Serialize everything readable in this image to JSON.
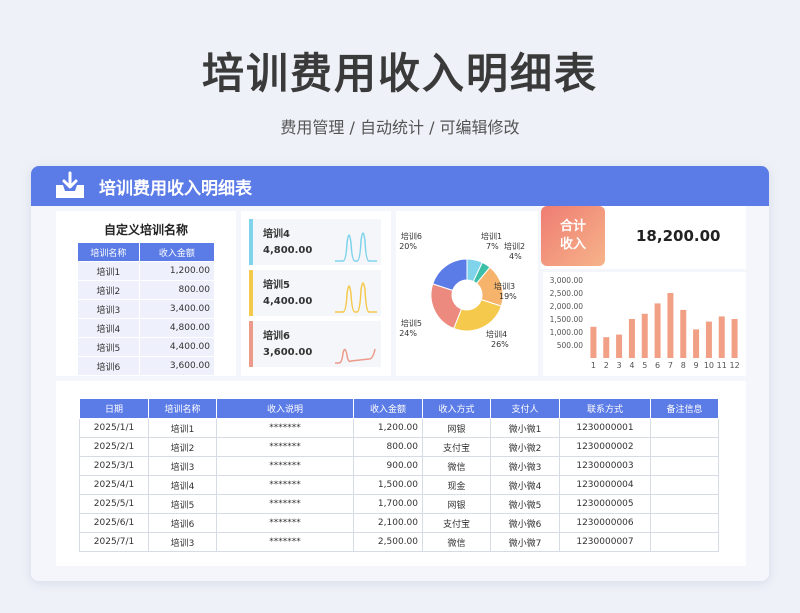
{
  "main_title": "培训费用收入明细表",
  "sub_title": "费用管理 /  自动统计  /  可编辑修改",
  "card_title": "培训费用收入明细表",
  "colors": {
    "accent": "#5b7be6",
    "orange": "#f0907a"
  },
  "custom_table": {
    "title": "自定义培训名称",
    "headers": [
      "培训名称",
      "收入金额"
    ],
    "rows": [
      [
        "培训1",
        "1,200.00"
      ],
      [
        "培训2",
        "800.00"
      ],
      [
        "培训3",
        "3,400.00"
      ],
      [
        "培训4",
        "4,800.00"
      ],
      [
        "培训5",
        "4,400.00"
      ],
      [
        "培训6",
        "3,600.00"
      ]
    ]
  },
  "mini_cards": [
    {
      "name": "培训4",
      "value": "4,800.00",
      "color": "#7fd3ea"
    },
    {
      "name": "培训5",
      "value": "4,400.00",
      "color": "#f5c94c"
    },
    {
      "name": "培训6",
      "value": "3,600.00",
      "color": "#ec9a8a"
    }
  ],
  "total": {
    "label_line1": "合计",
    "label_line2": "收入",
    "value": "18,200.00"
  },
  "chart_data": [
    {
      "type": "pie",
      "labels": [
        "培训1",
        "培训2",
        "培训3",
        "培训4",
        "培训5",
        "培训6"
      ],
      "values": [
        7,
        4,
        19,
        26,
        24,
        20
      ],
      "label_texts": [
        "7%",
        "4%",
        "19%",
        "26%",
        "24%",
        "20%"
      ],
      "colors": [
        "#7fd3ea",
        "#3cbfa7",
        "#f5b36c",
        "#f5c94c",
        "#ec8a80",
        "#5b7be6"
      ]
    },
    {
      "type": "bar",
      "categories": [
        "1",
        "2",
        "3",
        "4",
        "5",
        "6",
        "7",
        "8",
        "9",
        "10",
        "11",
        "12"
      ],
      "values": [
        1200,
        800,
        900,
        1500,
        1700,
        2100,
        2500,
        1850,
        1100,
        1400,
        1600,
        1500
      ],
      "ylim": [
        0,
        3000
      ],
      "yticks": [
        "500.00",
        "1,000.00",
        "1,500.00",
        "2,000.00",
        "2,500.00",
        "3,000.00"
      ]
    }
  ],
  "data_table": {
    "headers": [
      "日期",
      "培训名称",
      "收入说明",
      "收入金额",
      "收入方式",
      "支付人",
      "联系方式",
      "备注信息"
    ],
    "rows": [
      [
        "2025/1/1",
        "培训1",
        "*******",
        "1,200.00",
        "网银",
        "微小微1",
        "1230000001",
        ""
      ],
      [
        "2025/2/1",
        "培训2",
        "*******",
        "800.00",
        "支付宝",
        "微小微2",
        "1230000002",
        ""
      ],
      [
        "2025/3/1",
        "培训3",
        "*******",
        "900.00",
        "微信",
        "微小微3",
        "1230000003",
        ""
      ],
      [
        "2025/4/1",
        "培训4",
        "*******",
        "1,500.00",
        "现金",
        "微小微4",
        "1230000004",
        ""
      ],
      [
        "2025/5/1",
        "培训5",
        "*******",
        "1,700.00",
        "网银",
        "微小微5",
        "1230000005",
        ""
      ],
      [
        "2025/6/1",
        "培训6",
        "*******",
        "2,100.00",
        "支付宝",
        "微小微6",
        "1230000006",
        ""
      ],
      [
        "2025/7/1",
        "培训3",
        "*******",
        "2,500.00",
        "微信",
        "微小微7",
        "1230000007",
        ""
      ]
    ]
  }
}
